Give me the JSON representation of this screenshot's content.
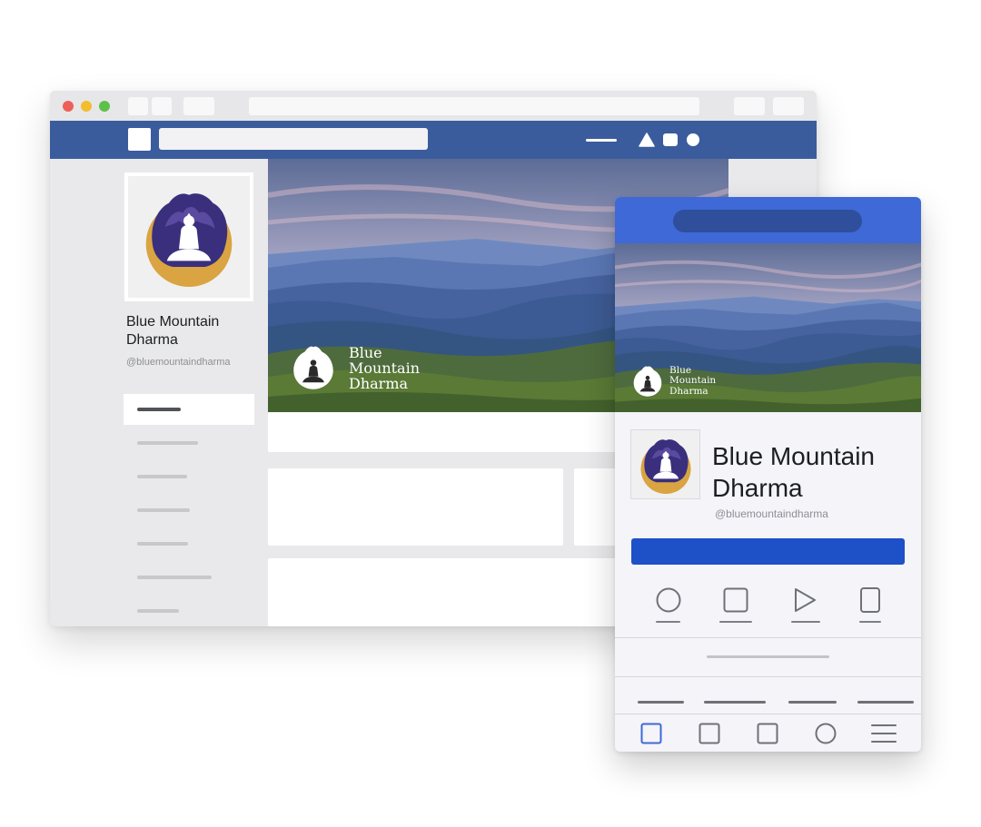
{
  "page": {
    "name": "Blue Mountain Dharma",
    "handle": "@bluemountaindharma"
  },
  "cover_brand": {
    "line1": "Blue",
    "line2": "Mountain",
    "line3": "Dharma"
  },
  "colors": {
    "facebook_bar": "#3b5c9c",
    "mobile_header": "#3e69d6",
    "mobile_cta": "#1e50c7",
    "logo_purple": "#3a2f7c",
    "logo_gold": "#d9a441"
  },
  "icons": {
    "toolbar": [
      "triangle-icon",
      "square-icon",
      "circle-icon"
    ],
    "mobile_row": [
      "circle-icon",
      "square-icon",
      "play-icon",
      "phone-icon"
    ],
    "mobile_nav": [
      "square-icon",
      "square-icon",
      "square-icon",
      "circle-icon",
      "menu-icon"
    ]
  }
}
